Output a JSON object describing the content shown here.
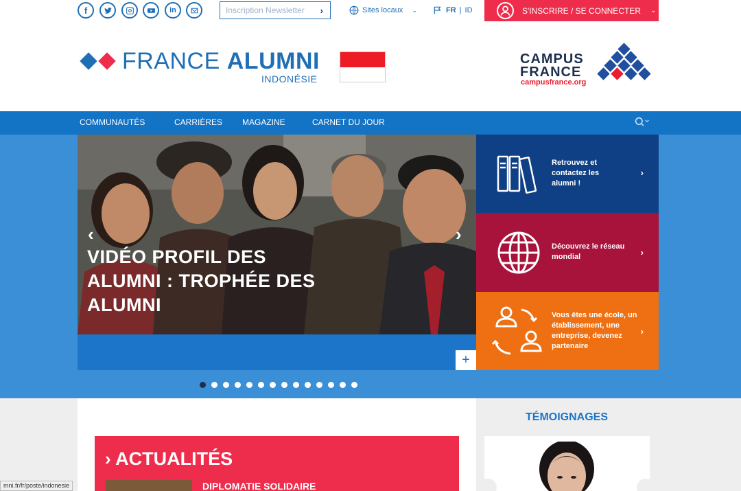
{
  "topbar": {
    "social": [
      {
        "icon": "facebook-icon",
        "glyph": "f"
      },
      {
        "icon": "twitter-icon",
        "glyph": "t"
      },
      {
        "icon": "instagram-icon",
        "glyph": "◎"
      },
      {
        "icon": "youtube-icon",
        "glyph": "▶"
      },
      {
        "icon": "linkedin-icon",
        "glyph": "in"
      },
      {
        "icon": "mail-icon",
        "glyph": "✉"
      }
    ],
    "newsletter_placeholder": "Inscription Newsletter",
    "sites_label": "Sites locaux",
    "lang_active": "FR",
    "lang_separator": "|",
    "lang_other": "ID",
    "login_label": "S'INSCRIRE / SE CONNECTER"
  },
  "logo": {
    "france": "FRANCE",
    "alumni": "ALUMNI",
    "country": "INDONÉSIE",
    "campus_line1": "CAMPUS",
    "campus_line2": "FRANCE",
    "campus_url": "campusfrance.org"
  },
  "nav": {
    "items": [
      "COMMUNAUTÉS",
      "CARRIÈRES",
      "MAGAZINE",
      "CARNET DU JOUR"
    ]
  },
  "hero": {
    "title": "VIDÉO PROFIL DES ALUMNI : TROPHÉE DES ALUMNI",
    "prev": "‹",
    "next": "›",
    "expand": "+",
    "slide_count": 14,
    "active_slide": 1
  },
  "panels": [
    {
      "text": "Retrouvez et contactez les alumni !",
      "icon": "binders-icon",
      "color": "#0f3f84"
    },
    {
      "text": "Découvrez le réseau mondial",
      "icon": "globe-icon",
      "color": "#a8133c"
    },
    {
      "text": "Vous êtes une école, un établissement, une entreprise, devenez partenaire",
      "icon": "exchange-people-icon",
      "color": "#ee7012"
    }
  ],
  "news": {
    "title": "ACTUALITÉS",
    "first_item": "DIPLOMATIE SOLIDAIRE"
  },
  "testimonials": {
    "title": "TÉMOIGNAGES"
  },
  "statusbar": "mni.fr/fr/poste/indonesie",
  "colors": {
    "brand_blue": "#1f6fb6",
    "nav_blue": "#1373c4",
    "accent_red": "#ee2c4c",
    "hero_bg": "#3a8fd6"
  }
}
